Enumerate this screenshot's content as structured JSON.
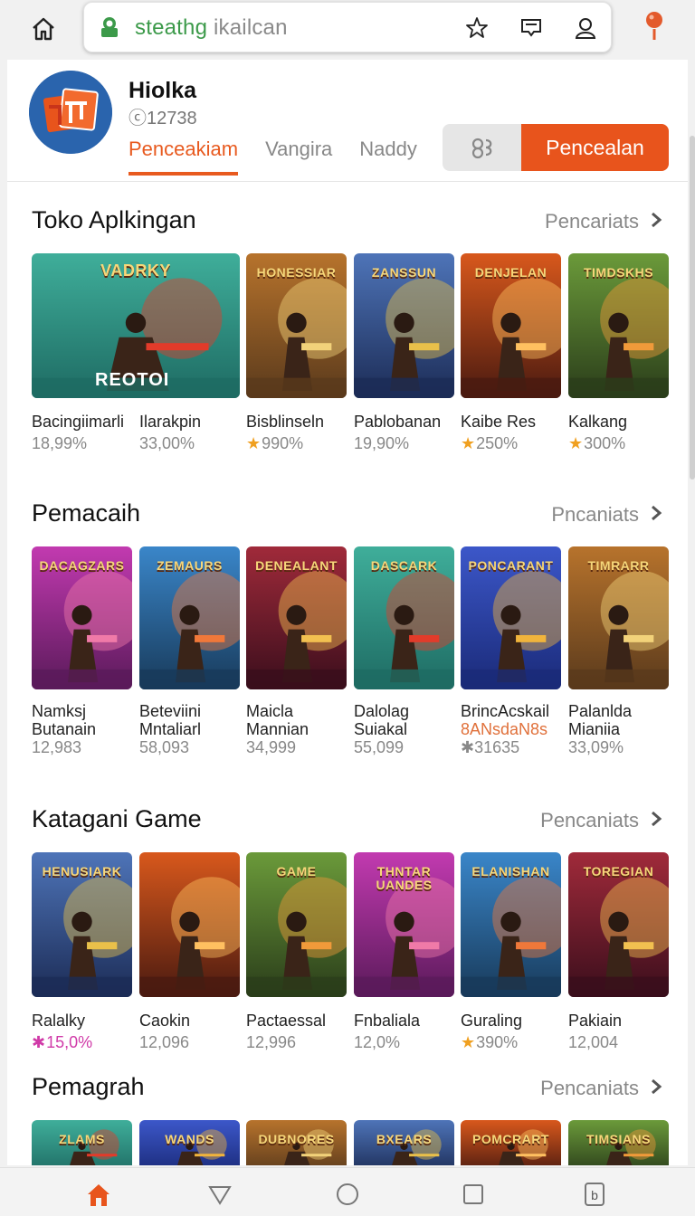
{
  "browser": {
    "url_main": "steathg",
    "url_rest": " ikailcan",
    "icons": [
      "home-icon",
      "lock-icon",
      "star-icon",
      "message-icon",
      "profile-icon",
      "location-pin-icon"
    ]
  },
  "app": {
    "name": "Hiolka",
    "count": "ⓒ12738",
    "tabs": [
      "Penceakiam",
      "Vangira",
      "Naddy"
    ],
    "active_tab": 0,
    "action_button": "Pencealan",
    "colors": {
      "accent": "#e8541c",
      "logo_bg": "#2a64ad"
    }
  },
  "sections": [
    {
      "title": "Toko Aplkingan",
      "more": "Pencariats",
      "items": [
        {
          "name": "Bacingiimarli",
          "sub": "18,99%",
          "sub_style": "plain",
          "art": "VADRKY",
          "art2": "REOTOI",
          "wide": true
        },
        {
          "name": "Ilarakpin",
          "sub": "33,00%",
          "sub_style": "plain"
        },
        {
          "name": "Bisblinseln",
          "sub": "990%",
          "sub_style": "star",
          "art": "HONESSIAR"
        },
        {
          "name": "Pablobanan",
          "sub": "19,90%",
          "sub_style": "plain",
          "art": "ZANSSUN"
        },
        {
          "name": "Kaibe Res",
          "sub": "250%",
          "sub_style": "star",
          "art": "DENJELAN"
        },
        {
          "name": "Kalkang",
          "sub": "300%",
          "sub_style": "star",
          "art": "TIMDSKHS"
        }
      ]
    },
    {
      "title": "Pemacaih",
      "more": "Pncaniats",
      "items": [
        {
          "name": "Namksj",
          "name2": "Butanain",
          "sub": "12,983",
          "sub_style": "plain",
          "art": "DACAGZARS"
        },
        {
          "name": "Beteviini",
          "name2": "Mntaliarl",
          "sub": "58,093",
          "sub_style": "plain",
          "art": "ZEMAURS"
        },
        {
          "name": "Maicla",
          "name2": "Mannian",
          "sub": "34,999",
          "sub_style": "plain",
          "art": "DENEALANT"
        },
        {
          "name": "Dalolag",
          "name2": "Suiakal",
          "sub": "55,099",
          "sub_style": "plain",
          "art": "DASCARK"
        },
        {
          "name": "BrincAcskail",
          "name2": "8ANsdaN8s",
          "sub": "✱31635",
          "sub_style": "plain",
          "name2_style": "orange",
          "art": "PONCARANT"
        },
        {
          "name": "Palanlda",
          "name2": "Mianiia",
          "sub": "33,09%",
          "sub_style": "plain",
          "art": "TIMRARR"
        }
      ]
    },
    {
      "title": "Katagani Game",
      "more": "Pencaniats",
      "items": [
        {
          "name": "Ralalky",
          "sub": "15,0%",
          "sub_style": "pink",
          "art": "HENUSIARK"
        },
        {
          "name": "Caokin",
          "sub": "12,096",
          "sub_style": "plain",
          "art": ""
        },
        {
          "name": "Pactaessal",
          "sub": "12,996",
          "sub_style": "plain",
          "art": "GAME"
        },
        {
          "name": "Fnbaliala",
          "sub": "12,0%",
          "sub_style": "plain",
          "art": "THNTAR UANDES"
        },
        {
          "name": "Guraling",
          "sub": "390%",
          "sub_style": "star",
          "art": "ELANISHAN"
        },
        {
          "name": "Pakiain",
          "sub": "12,004",
          "sub_style": "plain",
          "art": "TOREGIAN"
        }
      ]
    },
    {
      "title": "Pemagrah",
      "more": "Pencaniats",
      "items": [
        {
          "art": "ZLAMS"
        },
        {
          "art": "WANDS"
        },
        {
          "art": "DUBNORES"
        },
        {
          "art": "BXEARS"
        },
        {
          "art": "POMCRART"
        },
        {
          "art": "TIMSIANS"
        }
      ]
    }
  ],
  "nav": [
    "home-icon",
    "back-triangle-icon",
    "circle-home-icon",
    "square-recents-icon",
    "b-app-icon"
  ]
}
